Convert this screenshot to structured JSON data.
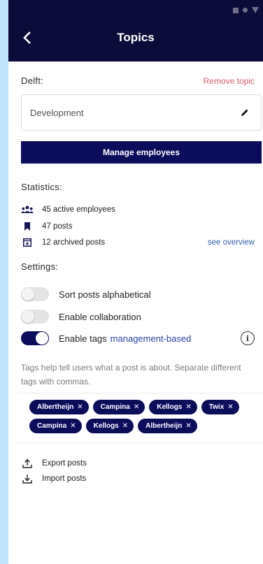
{
  "appbar": {
    "title": "Topics",
    "back_icon": "chevron-left-icon",
    "status_icons": [
      "square-icon",
      "circle-icon",
      "triangle-icon"
    ]
  },
  "topic": {
    "label": "Delft:",
    "remove_label": "Remove topic",
    "name_value": "Development",
    "edit_icon": "pencil-icon"
  },
  "manage_button": "Manage employees",
  "statistics": {
    "label": "Statistics:",
    "items": [
      {
        "icon": "people-icon",
        "text": "45 active employees"
      },
      {
        "icon": "bookmark-icon",
        "text": "47 posts"
      },
      {
        "icon": "archive-icon",
        "text": "12 archived posts",
        "link": "see overview"
      }
    ]
  },
  "settings": {
    "label": "Settings:",
    "toggles": [
      {
        "text": "Sort posts alphabetical",
        "on": false
      },
      {
        "text": "Enable collaboration",
        "on": false
      },
      {
        "text": "Enable tags",
        "accent": "management-based",
        "on": true
      }
    ],
    "info_icon": "info-icon"
  },
  "help_text": "Tags help tell users what a post is about. Separate different tags with commas.",
  "tags": [
    [
      "Albertheijn",
      "Campina",
      "Kellogs",
      "Twix"
    ],
    [
      "Campina",
      "Kellogs",
      "Albertheijn"
    ]
  ],
  "actions": [
    {
      "icon": "upload-icon",
      "text": "Export posts"
    },
    {
      "icon": "download-icon",
      "text": "Import posts"
    }
  ],
  "colors": {
    "primary": "#0c0c5c",
    "appbar": "#0c0c3a",
    "danger_link": "#e0556a",
    "link": "#2e5fb3",
    "background": "#bfe3fb"
  }
}
